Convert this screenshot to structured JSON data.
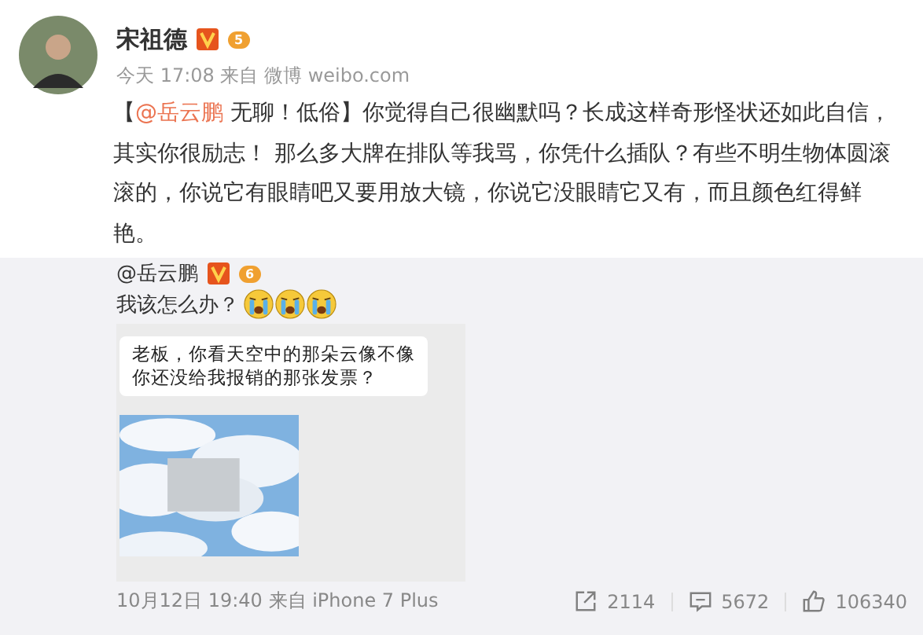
{
  "post": {
    "author": "宋祖德",
    "level": "5",
    "meta": "今天 17:08 来自 微博 weibo.com",
    "text_open": "【",
    "mention": "@岳云鹏",
    "text_rest": " 无聊！低俗】你觉得自己很幽默吗？长成这样奇形怪状还如此自信，其实你很励志！ 那么多大牌在排队等我骂，你凭什么插队？有些不明生物体圆滚滚的，你说它有眼睛吧又要用放大镜，你说它没眼睛它又有，而且颜色红得鲜艳。"
  },
  "repost": {
    "author": "@岳云鹏",
    "level": "6",
    "text": "我该怎么办？",
    "emojis": [
      {
        "kind": "crying"
      },
      {
        "kind": "crying"
      },
      {
        "kind": "crying"
      }
    ],
    "image": {
      "bubble_lines": [
        "老板，你看天空中的那朵云像不像",
        "你还没给我报销的那张发票？"
      ]
    },
    "meta": "10月12日 19:40 来自 iPhone 7 Plus",
    "actions": [
      {
        "kind": "share",
        "count": "2114"
      },
      {
        "kind": "comment",
        "count": "5672"
      },
      {
        "kind": "like",
        "count": "106340"
      }
    ]
  }
}
